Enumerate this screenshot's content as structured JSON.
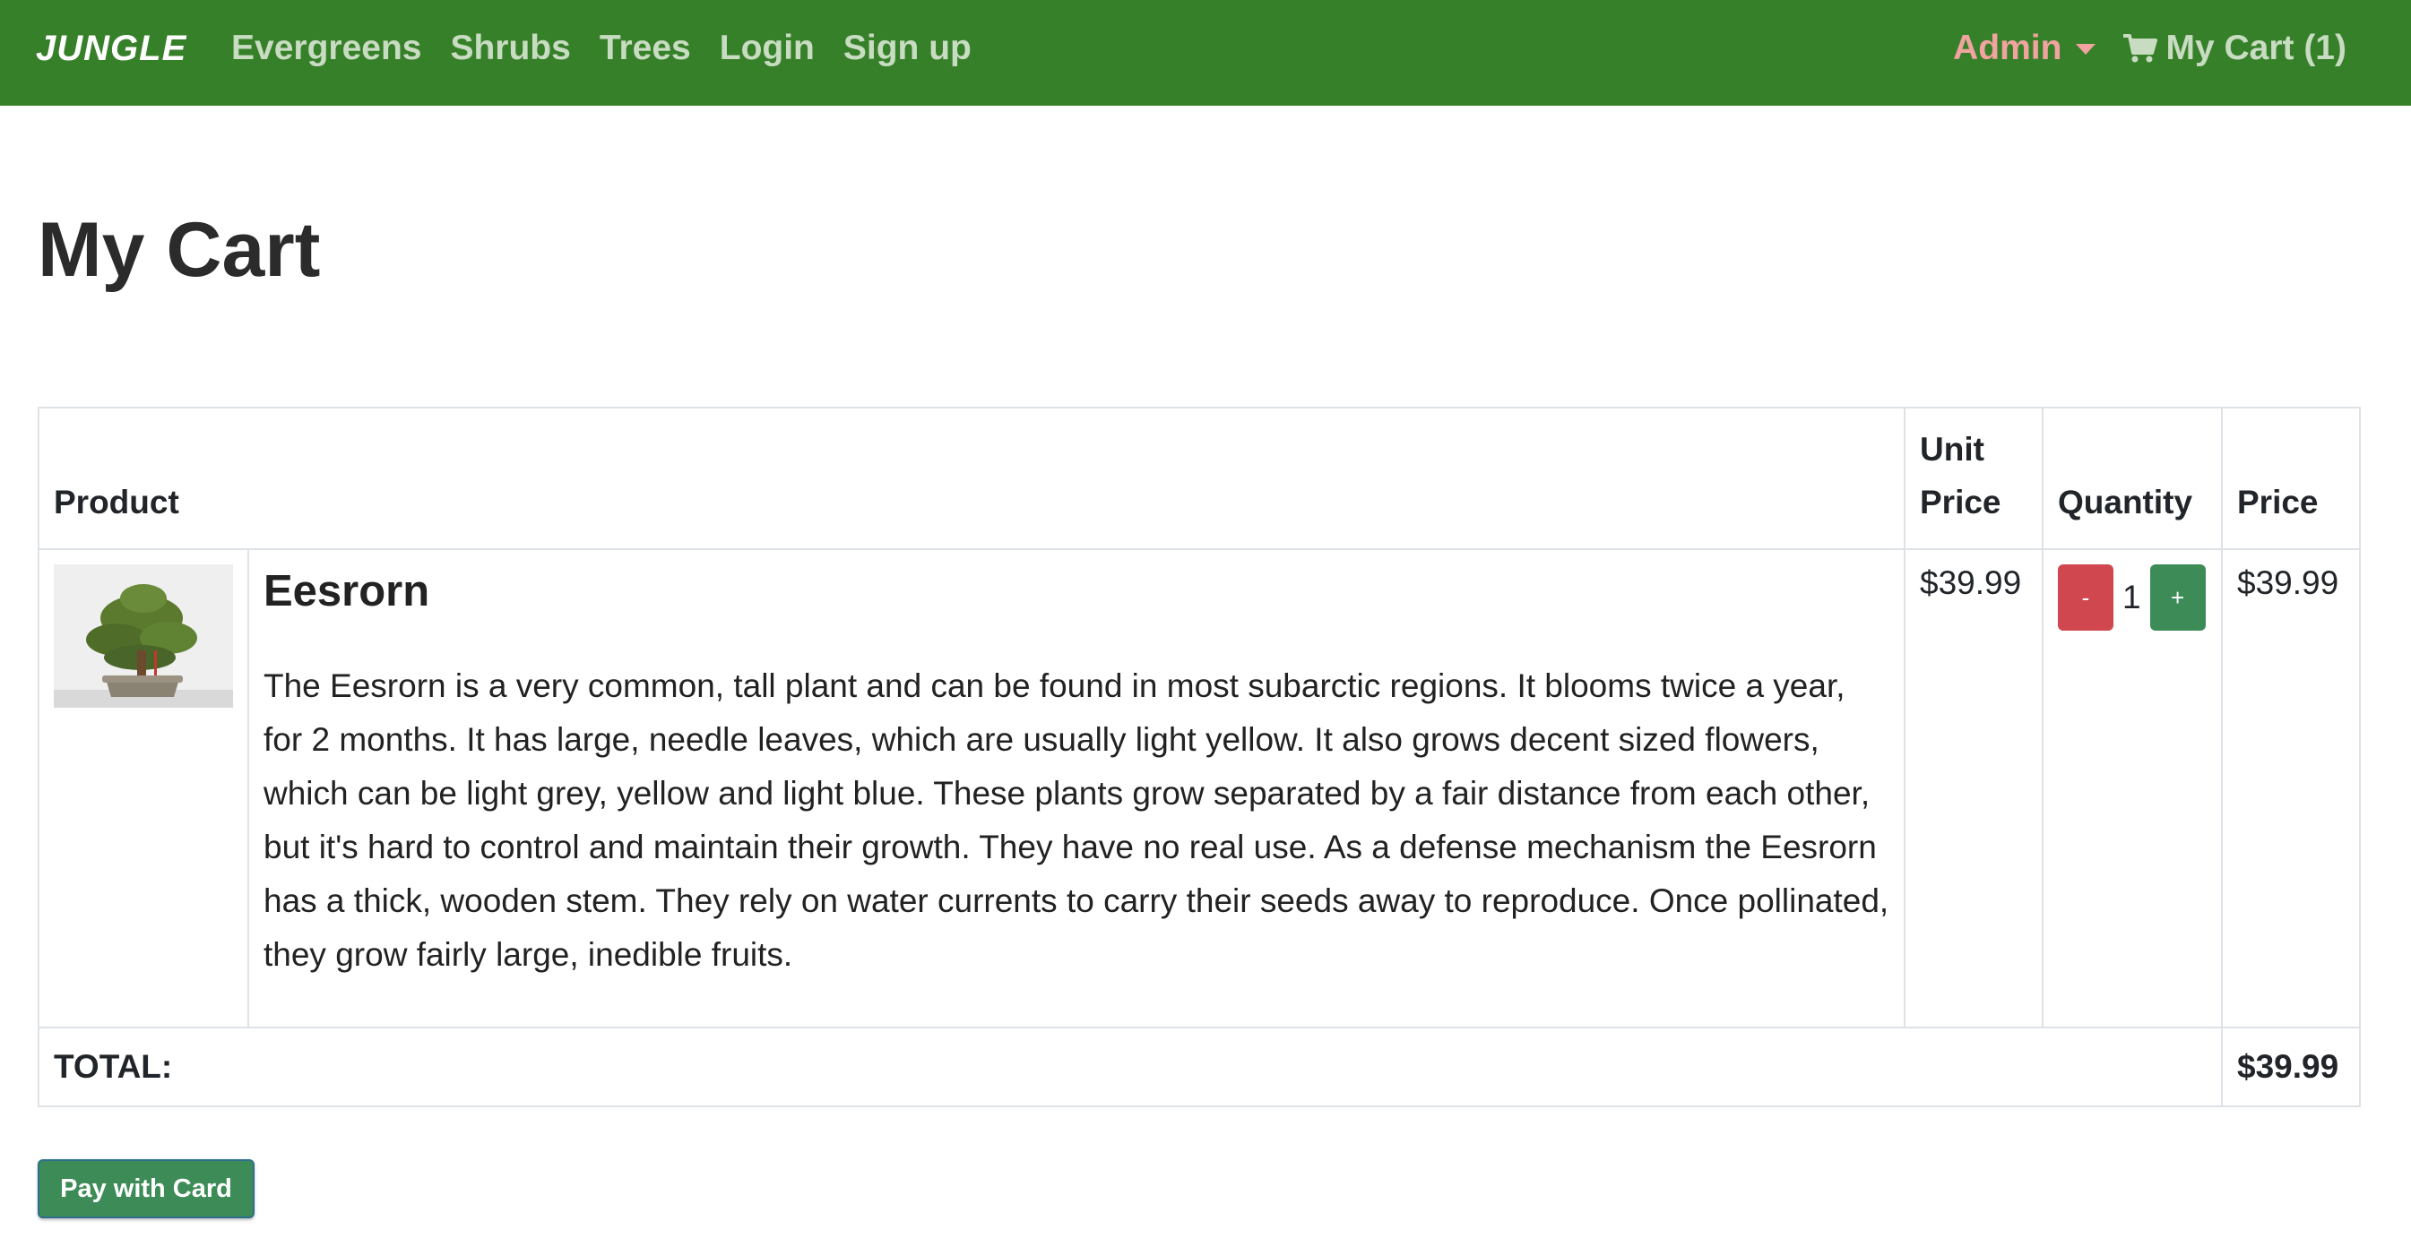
{
  "navbar": {
    "brand": "JUNGLE",
    "links": [
      "Evergreens",
      "Shrubs",
      "Trees",
      "Login",
      "Sign up"
    ],
    "admin_label": "Admin",
    "cart_label": "My Cart (1)",
    "background_color": "#37802a",
    "admin_color": "#f1a3a0"
  },
  "page": {
    "title": "My Cart"
  },
  "table": {
    "headers": {
      "product": "Product",
      "unit_price_line1": "Unit",
      "unit_price_line2": "Price",
      "quantity": "Quantity",
      "price": "Price"
    },
    "items": [
      {
        "name": "Eesrorn",
        "description": "The Eesrorn is a very common, tall plant and can be found in most subarctic regions. It blooms twice a year, for 2 months. It has large, needle leaves, which are usually light yellow. It also grows decent sized flowers, which can be light grey, yellow and light blue. These plants grow separated by a fair distance from each other, but it's hard to control and maintain their growth. They have no real use. As a defense mechanism the Eesrorn has a thick, wooden stem. They rely on water currents to carry their seeds away to reproduce. Once pollinated, they grow fairly large, inedible fruits.",
        "unit_price": "$39.99",
        "quantity": "1",
        "price": "$39.99",
        "minus_label": "-",
        "plus_label": "+",
        "image_icon": "bonsai-tree-image"
      }
    ],
    "total_label": "TOTAL:",
    "total_value": "$39.99"
  },
  "pay_button": {
    "label": "Pay with Card",
    "color": "#3d8c57"
  },
  "colors": {
    "minus_button": "#d0474f",
    "plus_button": "#3d8c57"
  }
}
